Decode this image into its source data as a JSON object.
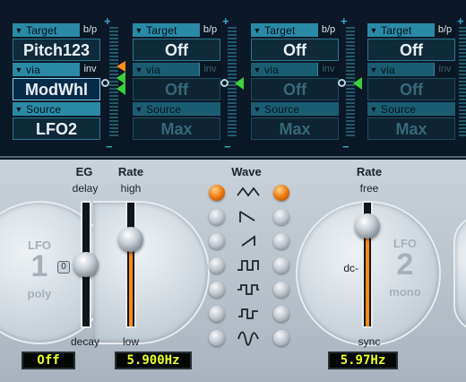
{
  "router": {
    "slots": [
      {
        "target_label": "Target",
        "target_tag": "b/p",
        "target_value": "Pitch123",
        "via_label": "via",
        "via_tag": "inv",
        "via_value": "ModWhl",
        "source_label": "Source",
        "source_value": "LFO2"
      },
      {
        "target_label": "Target",
        "target_tag": "b/p",
        "target_value": "Off",
        "via_label": "via",
        "via_tag": "inv",
        "via_value": "Off",
        "source_label": "Source",
        "source_value": "Max"
      },
      {
        "target_label": "Target",
        "target_tag": "b/p",
        "target_value": "Off",
        "via_label": "via",
        "via_tag": "inv",
        "via_value": "Off",
        "source_label": "Source",
        "source_value": "Max"
      },
      {
        "target_label": "Target",
        "target_tag": "b/p",
        "target_value": "Off",
        "via_label": "via",
        "via_tag": "inv",
        "via_value": "Off",
        "source_label": "Source",
        "source_value": "Max"
      }
    ],
    "plus": "+",
    "minus": "−"
  },
  "lfo1": {
    "word": "LFO",
    "number": "1",
    "mode": "poly",
    "zero_button": "0",
    "eg_label": "EG",
    "eg_top": "delay",
    "eg_bottom": "decay",
    "rate_label": "Rate",
    "rate_top": "high",
    "rate_bottom": "low",
    "eg_display": "Off",
    "rate_display": "5.900Hz",
    "eg_level": 0.5,
    "rate_level": 0.75
  },
  "wave": {
    "label": "Wave",
    "shapes": [
      "triangle-wave-icon",
      "sawtooth-down-icon",
      "sawtooth-up-icon",
      "square-unipolar-icon",
      "square-bipolar-icon",
      "sample-hold-icon",
      "smooth-random-icon"
    ],
    "left_selected": 0,
    "right_selected": 0
  },
  "lfo2": {
    "word": "LFO",
    "number": "2",
    "mode": "mono",
    "rate_label": "Rate",
    "rate_top": "free",
    "rate_bottom": "sync",
    "dc_label": "dc-",
    "rate_display": "5.97Hz",
    "rate_level": 0.88
  },
  "colors": {
    "accent_orange": "#ff8a1a",
    "lcd_text": "#e8ff2a",
    "router_cyan": "#2a8aa6",
    "mod_green": "#3ad23a"
  }
}
